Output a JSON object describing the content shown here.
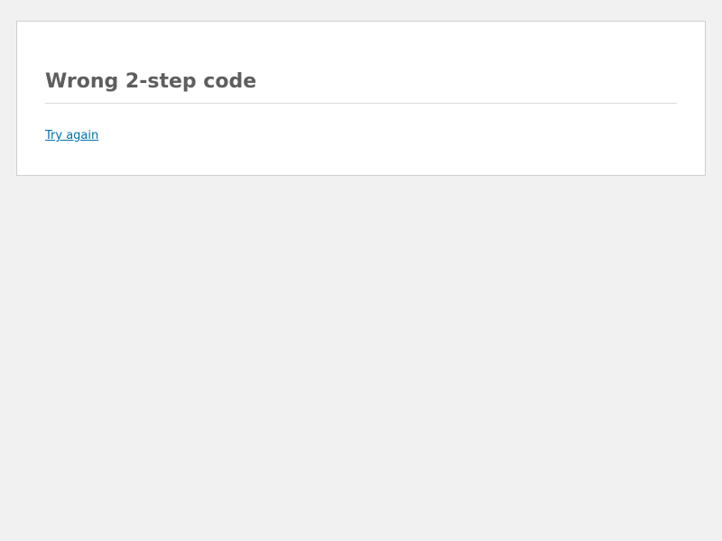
{
  "error": {
    "title": "Wrong 2-step code",
    "link_label": "Try again"
  },
  "colors": {
    "background": "#f1f1f1",
    "panel": "#ffffff",
    "title_text": "#5e5e5e",
    "link": "#0073aa"
  }
}
